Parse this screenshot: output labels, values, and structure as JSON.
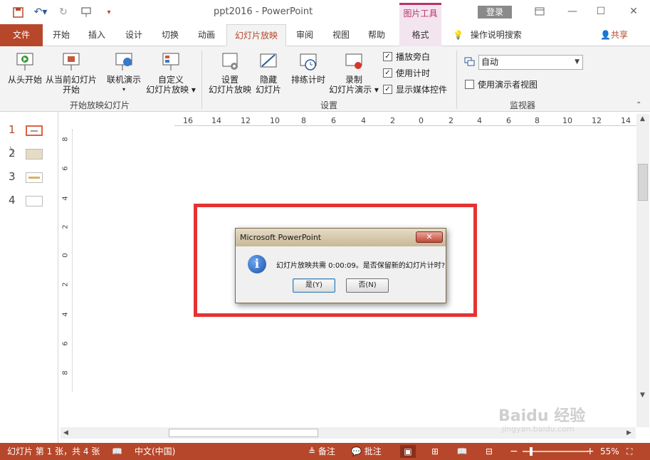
{
  "titlebar": {
    "title": "ppt2016 - PowerPoint",
    "context_tab_group": "图片工具",
    "login": "登录"
  },
  "tabs": [
    "文件",
    "开始",
    "插入",
    "设计",
    "切换",
    "动画",
    "幻灯片放映",
    "审阅",
    "视图",
    "帮助",
    "格式"
  ],
  "tell_me": "操作说明搜索",
  "share": "共享",
  "ribbon": {
    "start_group": {
      "label": "开始放映幻灯片",
      "from_beginning": "从头开始",
      "from_current_l1": "从当前幻灯片",
      "from_current_l2": "开始",
      "online": "联机演示",
      "custom_l1": "自定义",
      "custom_l2": "幻灯片放映"
    },
    "setup_group": {
      "label": "设置",
      "setup_l1": "设置",
      "setup_l2": "幻灯片放映",
      "hide_l1": "隐藏",
      "hide_l2": "幻灯片",
      "rehearse": "排练计时",
      "record_l1": "录制",
      "record_l2": "幻灯片演示",
      "play_narration": "播放旁白",
      "use_timings": "使用计时",
      "show_media_controls": "显示媒体控件"
    },
    "monitor_group": {
      "label": "监视器",
      "monitor_value": "自动",
      "presenter_view": "使用演示者视图"
    }
  },
  "slides": [
    "1",
    "2",
    "3",
    "4"
  ],
  "ruler": {
    "h": [
      "16",
      "14",
      "12",
      "10",
      "8",
      "6",
      "4",
      "2",
      "0",
      "2",
      "4",
      "6",
      "8",
      "10",
      "12",
      "14"
    ],
    "v": [
      "8",
      "6",
      "4",
      "2",
      "0",
      "2",
      "4",
      "6",
      "8"
    ]
  },
  "dialog": {
    "title": "Microsoft PowerPoint",
    "message": "幻灯片放映共需 0:00:09。是否保留新的幻灯片计时?",
    "yes": "是(Y)",
    "no": "否(N)"
  },
  "statusbar": {
    "slide_info": "幻灯片 第 1 张，共 4 张",
    "language": "中文(中国)",
    "notes": "备注",
    "comments": "批注",
    "zoom": "55%"
  },
  "watermark": {
    "brand": "Baidu 经验",
    "url": "jingyan.baidu.com"
  }
}
